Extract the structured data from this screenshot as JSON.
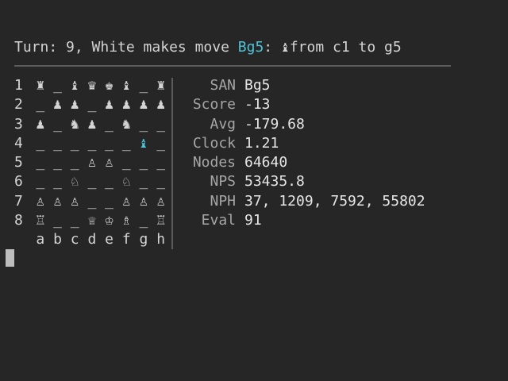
{
  "header": {
    "turn_prefix": "Turn: 9, White makes move ",
    "move": "Bg5",
    "colon": ": ",
    "piece": "♝",
    "from_to": "from c1 to g5"
  },
  "board": {
    "ranks": [
      {
        "label": "1",
        "cells": [
          "♜",
          "_",
          "♝",
          "♛",
          "♚",
          "♝",
          "_",
          "♜"
        ]
      },
      {
        "label": "2",
        "cells": [
          "_",
          "♟",
          "♟",
          "_",
          "♟",
          "♟",
          "♟",
          "♟"
        ]
      },
      {
        "label": "3",
        "cells": [
          "♟",
          "_",
          "♞",
          "♟",
          "_",
          "♞",
          "_",
          "_"
        ]
      },
      {
        "label": "4",
        "cells": [
          "_",
          "_",
          "_",
          "_",
          "_",
          "_",
          "♝",
          "_"
        ]
      },
      {
        "label": "5",
        "cells": [
          "_",
          "_",
          "_",
          "♙",
          "♙",
          "_",
          "_",
          "_"
        ]
      },
      {
        "label": "6",
        "cells": [
          "_",
          "_",
          "♘",
          "_",
          "_",
          "♘",
          "_",
          "_"
        ]
      },
      {
        "label": "7",
        "cells": [
          "♙",
          "♙",
          "♙",
          "_",
          "_",
          "♙",
          "♙",
          "♙"
        ]
      },
      {
        "label": "8",
        "cells": [
          "♖",
          "_",
          "_",
          "♕",
          "♔",
          "♗",
          "_",
          "♖"
        ]
      }
    ],
    "files": [
      "a",
      "b",
      "c",
      "d",
      "e",
      "f",
      "g",
      "h"
    ],
    "highlight_color": "#4ec3d6"
  },
  "stats": [
    {
      "label": "SAN",
      "value": "Bg5"
    },
    {
      "label": "Score",
      "value": "-13"
    },
    {
      "label": "Avg",
      "value": "-179.68"
    },
    {
      "label": "Clock",
      "value": "1.21"
    },
    {
      "label": "Nodes",
      "value": "64640"
    },
    {
      "label": "NPS",
      "value": "53435.8"
    },
    {
      "label": "NPH",
      "value": "37, 1209, 7592, 55802"
    },
    {
      "label": "Eval",
      "value": "91"
    }
  ]
}
